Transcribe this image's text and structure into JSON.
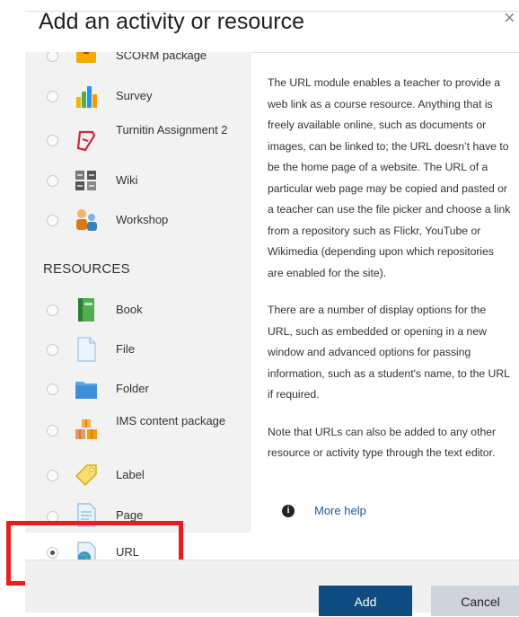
{
  "dialog": {
    "title": "Add an activity or resource",
    "close_glyph": "×"
  },
  "activities": [
    {
      "label": "SCORM package",
      "icon": "scorm-icon"
    },
    {
      "label": "Survey",
      "icon": "survey-chart-icon"
    },
    {
      "label": "Turnitin Assignment 2",
      "icon": "turnitin-icon"
    },
    {
      "label": "Wiki",
      "icon": "wiki-icon"
    },
    {
      "label": "Workshop",
      "icon": "workshop-icon"
    }
  ],
  "resources_heading": "RESOURCES",
  "resources": [
    {
      "label": "Book",
      "icon": "book-icon"
    },
    {
      "label": "File",
      "icon": "file-icon"
    },
    {
      "label": "Folder",
      "icon": "folder-icon"
    },
    {
      "label": "IMS content package",
      "icon": "ims-package-icon"
    },
    {
      "label": "Label",
      "icon": "label-tag-icon"
    },
    {
      "label": "Page",
      "icon": "page-icon"
    },
    {
      "label": "URL",
      "icon": "url-globe-icon",
      "selected": true
    }
  ],
  "description": [
    "The URL module enables a teacher to provide a web link as a course resource. Anything that is freely available online, such as documents or images, can be linked to; the URL doesn’t have to be the home page of a website. The URL of a particular web page may be copied and pasted or a teacher can use the file picker and choose a link from a repository such as Flickr, YouTube or Wikimedia (depending upon which repositories are enabled for the site).",
    "There are a number of display options for the URL, such as embedded or opening in a new window and advanced options for passing information, such as a student's name, to the URL if required.",
    "Note that URLs can also be added to any other resource or activity type through the text editor."
  ],
  "more_help": "More help",
  "buttons": {
    "add": "Add",
    "cancel": "Cancel"
  },
  "colors": {
    "primary": "#0f4c81",
    "highlight": "#ea1c1c"
  }
}
